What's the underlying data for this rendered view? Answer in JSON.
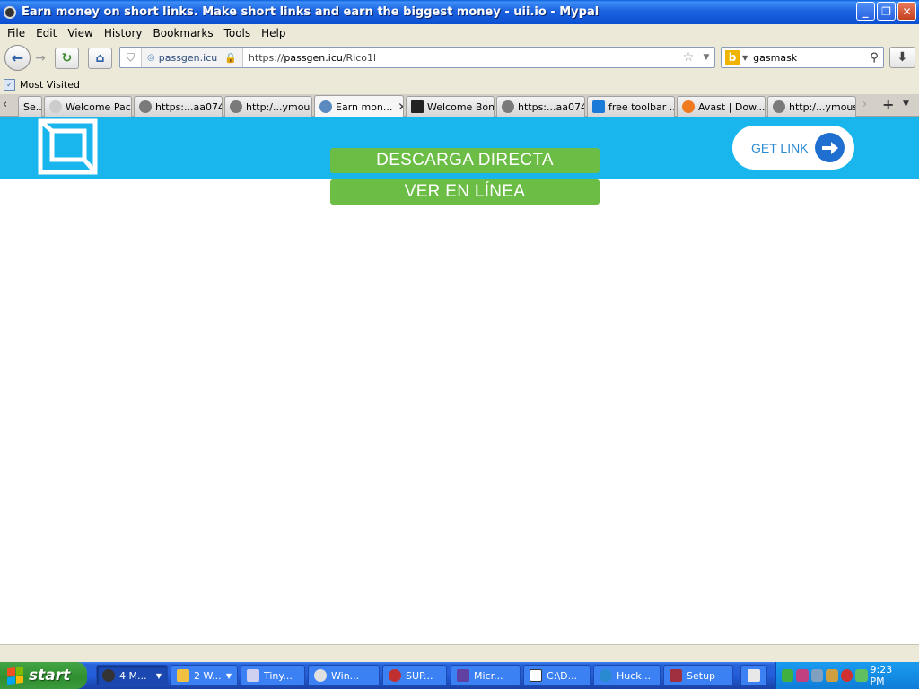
{
  "window": {
    "title": "Earn money on short links. Make short links and earn the biggest money - uii.io - Mypal",
    "controls": {
      "minimize": "_",
      "restore": "❐",
      "close": "✕"
    }
  },
  "menu": [
    "File",
    "Edit",
    "View",
    "History",
    "Bookmarks",
    "Tools",
    "Help"
  ],
  "nav": {
    "identity": "passgen.icu",
    "url_prefix": "https://",
    "url_host": "passgen.icu",
    "url_path": "/Rico1l",
    "search_value": "gasmask"
  },
  "bookmarks": {
    "most_visited": "Most Visited"
  },
  "tabs": [
    {
      "label": "Se...",
      "icon_color": "#888888",
      "active": false
    },
    {
      "label": "Welcome Pac...",
      "icon_color": "#cccccc",
      "active": false
    },
    {
      "label": "https:...aa074f",
      "icon_color": "#7a7a7a",
      "active": false
    },
    {
      "label": "http:/...ymous/",
      "icon_color": "#7a7a7a",
      "active": false
    },
    {
      "label": "Earn mon...",
      "icon_color": "#5a8ac0",
      "active": true
    },
    {
      "label": "Welcome Bon...",
      "icon_color": "#222222",
      "active": false
    },
    {
      "label": "https:...aa074f",
      "icon_color": "#7a7a7a",
      "active": false
    },
    {
      "label": "free toolbar ...",
      "icon_color": "#1a7ad8",
      "active": false
    },
    {
      "label": "Avast | Dow...",
      "icon_color": "#f07a20",
      "active": false
    },
    {
      "label": "http:/...ymous/",
      "icon_color": "#7a7a7a",
      "active": false
    }
  ],
  "page": {
    "get_link": "GET LINK",
    "download_direct": "DESCARGA DIRECTA",
    "watch_online": "VER EN LÍNEA",
    "header_color": "#19b6ee",
    "button_color": "#6cbd45"
  },
  "taskbar": {
    "start": "start",
    "items": [
      {
        "label": "4 M...",
        "icon_color": "#333333",
        "active": true,
        "group": true
      },
      {
        "label": "2 W...",
        "icon_color": "#f0c040",
        "active": false,
        "group": true
      },
      {
        "label": "Tiny...",
        "icon_color": "#d0d0f0",
        "active": false,
        "group": false
      },
      {
        "label": "Win...",
        "icon_color": "#e0e0e0",
        "active": false,
        "group": false
      },
      {
        "label": "SUP...",
        "icon_color": "#c03030",
        "active": false,
        "group": false
      },
      {
        "label": "Micr...",
        "icon_color": "#6040a0",
        "active": false,
        "group": false
      },
      {
        "label": "C:\\D...",
        "icon_color": "#ffffff",
        "active": false,
        "group": false
      },
      {
        "label": "Huck...",
        "icon_color": "#2a8ad0",
        "active": false,
        "group": false
      },
      {
        "label": "Setup",
        "icon_color": "#a03040",
        "active": false,
        "group": false
      }
    ],
    "clock": "9:23 PM"
  }
}
